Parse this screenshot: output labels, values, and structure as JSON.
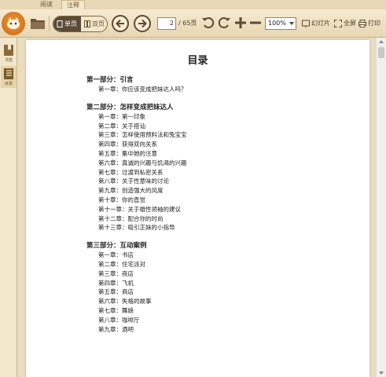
{
  "tabs": [
    {
      "label": "阅读"
    },
    {
      "label": "注释"
    }
  ],
  "toolbar": {
    "view_single": "单页",
    "view_double": "双页",
    "page_current": "2",
    "page_total": "/ 65页",
    "zoom": "100%",
    "slideshow": "幻灯片",
    "fullscreen": "全屏",
    "print": "打印"
  },
  "sidebar": {
    "items": [
      {
        "label": "书签"
      },
      {
        "label": "目录"
      }
    ]
  },
  "document": {
    "title": "目录",
    "parts": [
      {
        "heading": "第一部分：引言",
        "chapters": [
          "第一章：你应该变成把妹达人吗？"
        ]
      },
      {
        "heading": "第二部分：怎样变成把妹达人",
        "chapters": [
          "第一章：第一印象",
          "第二章：关于搭讪",
          "第三章：怎样使用预料法和兔宝宝",
          "第四章：获得双向关系",
          "第五章：集中她的注意",
          "第六章：真诚的兴趣与饥渴的兴趣",
          "第七章：过渡到私密关系",
          "第八章：关于性意味的讨论",
          "第九章：创造强大的风度",
          "第十章：你的直觉",
          "第十一章：关于雄性领袖的建议",
          "第十二章：配合你的时尚",
          "第十三章：吸引正妹的小指导"
        ]
      },
      {
        "heading": "第三部分：互动案例",
        "chapters": [
          "第一章：书店",
          "第二章：住宅派对",
          "第三章：夜店",
          "第四章：飞机",
          "第五章：商店",
          "第六章：失格的故事",
          "第七章：舞娘",
          "第八章：咖啡厅",
          "第九章：酒吧"
        ]
      }
    ]
  }
}
